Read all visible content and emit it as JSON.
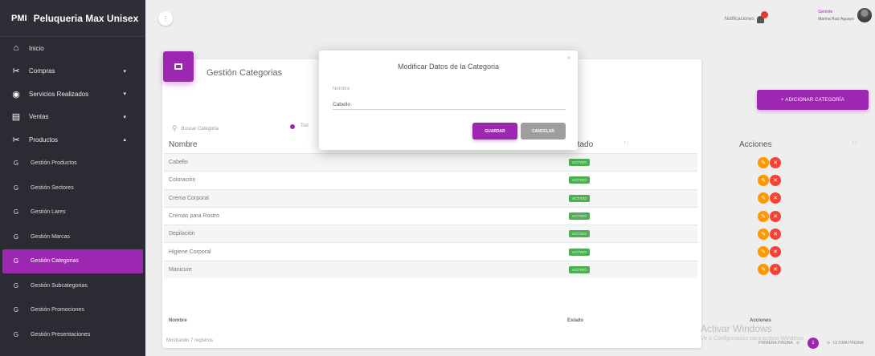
{
  "app": {
    "abbr": "PMI",
    "name": "Peluqueria Max Unisex"
  },
  "sidebar": {
    "items": [
      {
        "label": "Inicio",
        "icon": "⌂"
      },
      {
        "label": "Compras",
        "icon": "✂",
        "caret": "▾"
      },
      {
        "label": "Servicios Realizados",
        "icon": "◉",
        "caret": "▾"
      },
      {
        "label": "Ventas",
        "icon": "▤",
        "caret": "▾"
      },
      {
        "label": "Productos",
        "icon": "✂",
        "caret": "▴"
      }
    ],
    "subitems": [
      {
        "letter": "G",
        "label": "Gestión Productos"
      },
      {
        "letter": "G",
        "label": "Gestión Sectores"
      },
      {
        "letter": "G",
        "label": "Gestión Lares"
      },
      {
        "letter": "G",
        "label": "Gestión Marcas"
      },
      {
        "letter": "G",
        "label": "Gestión Categorias"
      },
      {
        "letter": "G",
        "label": "Gestión Subcategorias"
      },
      {
        "letter": "G",
        "label": "Gestión Promociones"
      },
      {
        "letter": "G",
        "label": "Gestión Presentaciones"
      }
    ]
  },
  "topbar": {
    "menu_glyph": "⋮",
    "notifications_label": "Notificaciones",
    "notifications_count": "",
    "user_role": "Gerente",
    "user_name": "Marina Ruiz Aguayo"
  },
  "page": {
    "title": "Gestión Categorias",
    "add_button": "+ ADICIONAR CATEGORÍA",
    "search_placeholder": "Buscar Categoria",
    "filter_label": "Tod"
  },
  "table": {
    "headers": {
      "name": "Nombre",
      "state": "Estado",
      "actions": "Acciones"
    },
    "footers": {
      "name": "Nombre",
      "state": "Estado",
      "actions": "Acciones"
    },
    "rows": [
      {
        "name": "Cabello",
        "state": "ACTIVO"
      },
      {
        "name": "Coloración",
        "state": "ACTIVO"
      },
      {
        "name": "Crema Corporal",
        "state": "ACTIVO"
      },
      {
        "name": "Cremas para Rostro",
        "state": "ACTIVO"
      },
      {
        "name": "Depilación",
        "state": "ACTIVO"
      },
      {
        "name": "Higiene Corporal",
        "state": "ACTIVO"
      },
      {
        "name": "Manicure",
        "state": "ACTIVO"
      }
    ],
    "showing": "Mostrando 7 registros"
  },
  "pagination": {
    "first": "PRIMERA PÁGINA",
    "prev": "<",
    "current": "1",
    "next": ">",
    "last": "ÚLTIMA PÁGINA"
  },
  "watermark": {
    "line1": "Activar Windows",
    "line2": "Ve a Configuración para activar Windows."
  },
  "modal": {
    "title": "Modificar Datos de la Categoria",
    "field_label": "Nombre",
    "field_value": "Cabello",
    "save": "GUARDAR",
    "cancel": "CANCELAR",
    "close": "×"
  },
  "colors": {
    "accent": "#9c27b0",
    "active_badge": "#4caf50",
    "edit": "#ff9800",
    "delete": "#f44336",
    "sidebar": "#2b2b33"
  }
}
